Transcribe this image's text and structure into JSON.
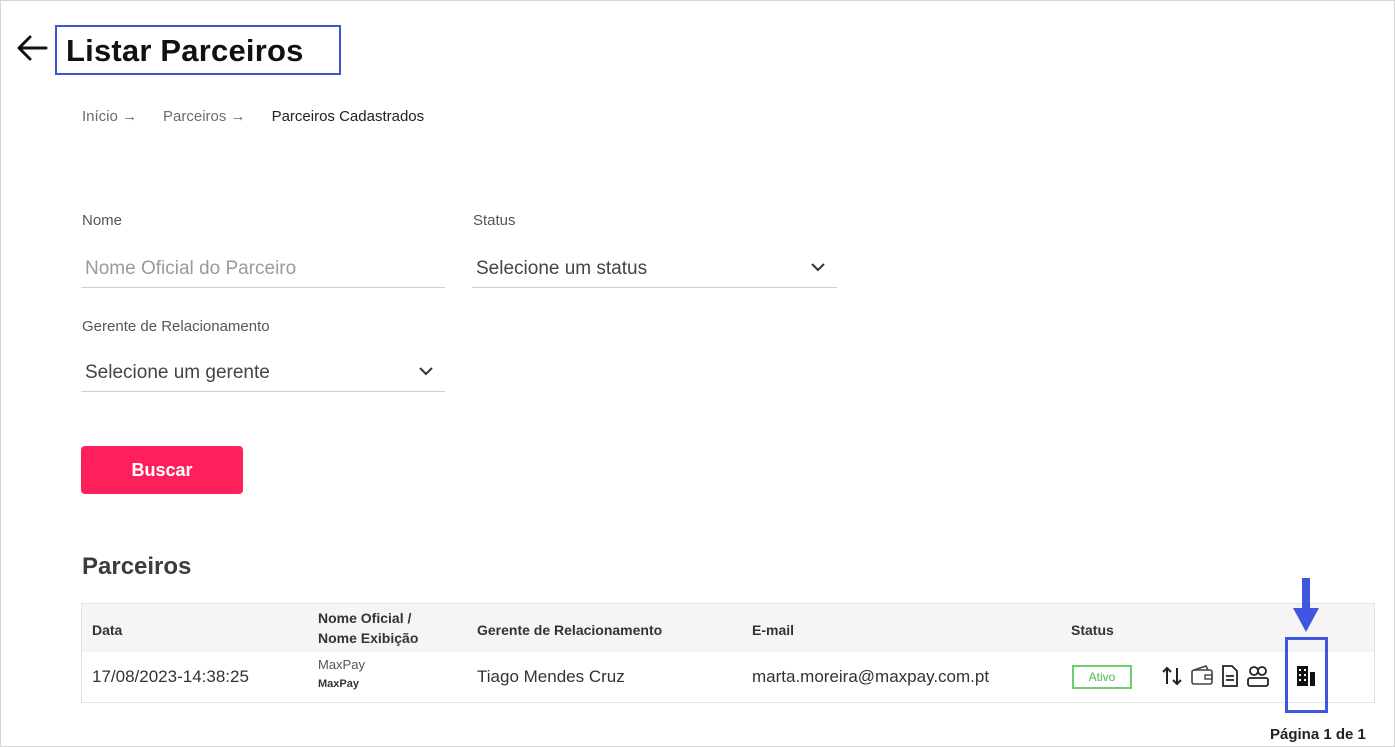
{
  "page": {
    "title": "Listar Parceiros",
    "back_icon": "arrow-left-icon"
  },
  "breadcrumb": {
    "items": [
      "Início →",
      "Parceiros →",
      "Parceiros Cadastrados"
    ]
  },
  "filters": {
    "nome_label": "Nome",
    "nome_placeholder": "Nome Oficial do Parceiro",
    "status_label": "Status",
    "status_value": "Selecione um status",
    "gerente_label": "Gerente de Relacionamento",
    "gerente_value": "Selecione um gerente",
    "buscar_label": "Buscar"
  },
  "results": {
    "section_title": "Parceiros",
    "columns": {
      "data": "Data",
      "nome_line1": "Nome Oficial /",
      "nome_line2": "Nome Exibição",
      "gerente": "Gerente de Relacionamento",
      "email": "E-mail",
      "status": "Status"
    },
    "rows": [
      {
        "data": "17/08/2023-14:38:25",
        "nome_oficial": "MaxPay",
        "nome_exibicao": "MaxPay",
        "gerente": "Tiago Mendes Cruz",
        "email": "marta.moreira@maxpay.com.pt",
        "status": "Ativo"
      }
    ],
    "row_actions": [
      "swap-arrows-icon",
      "wallet-icon",
      "document-icon",
      "users-icon",
      "building-icon"
    ],
    "pagination": "Página 1 de 1"
  },
  "colors": {
    "accent": "#ff1f5a",
    "highlight": "#3f57e0",
    "status_active": "#4cbb4c"
  }
}
